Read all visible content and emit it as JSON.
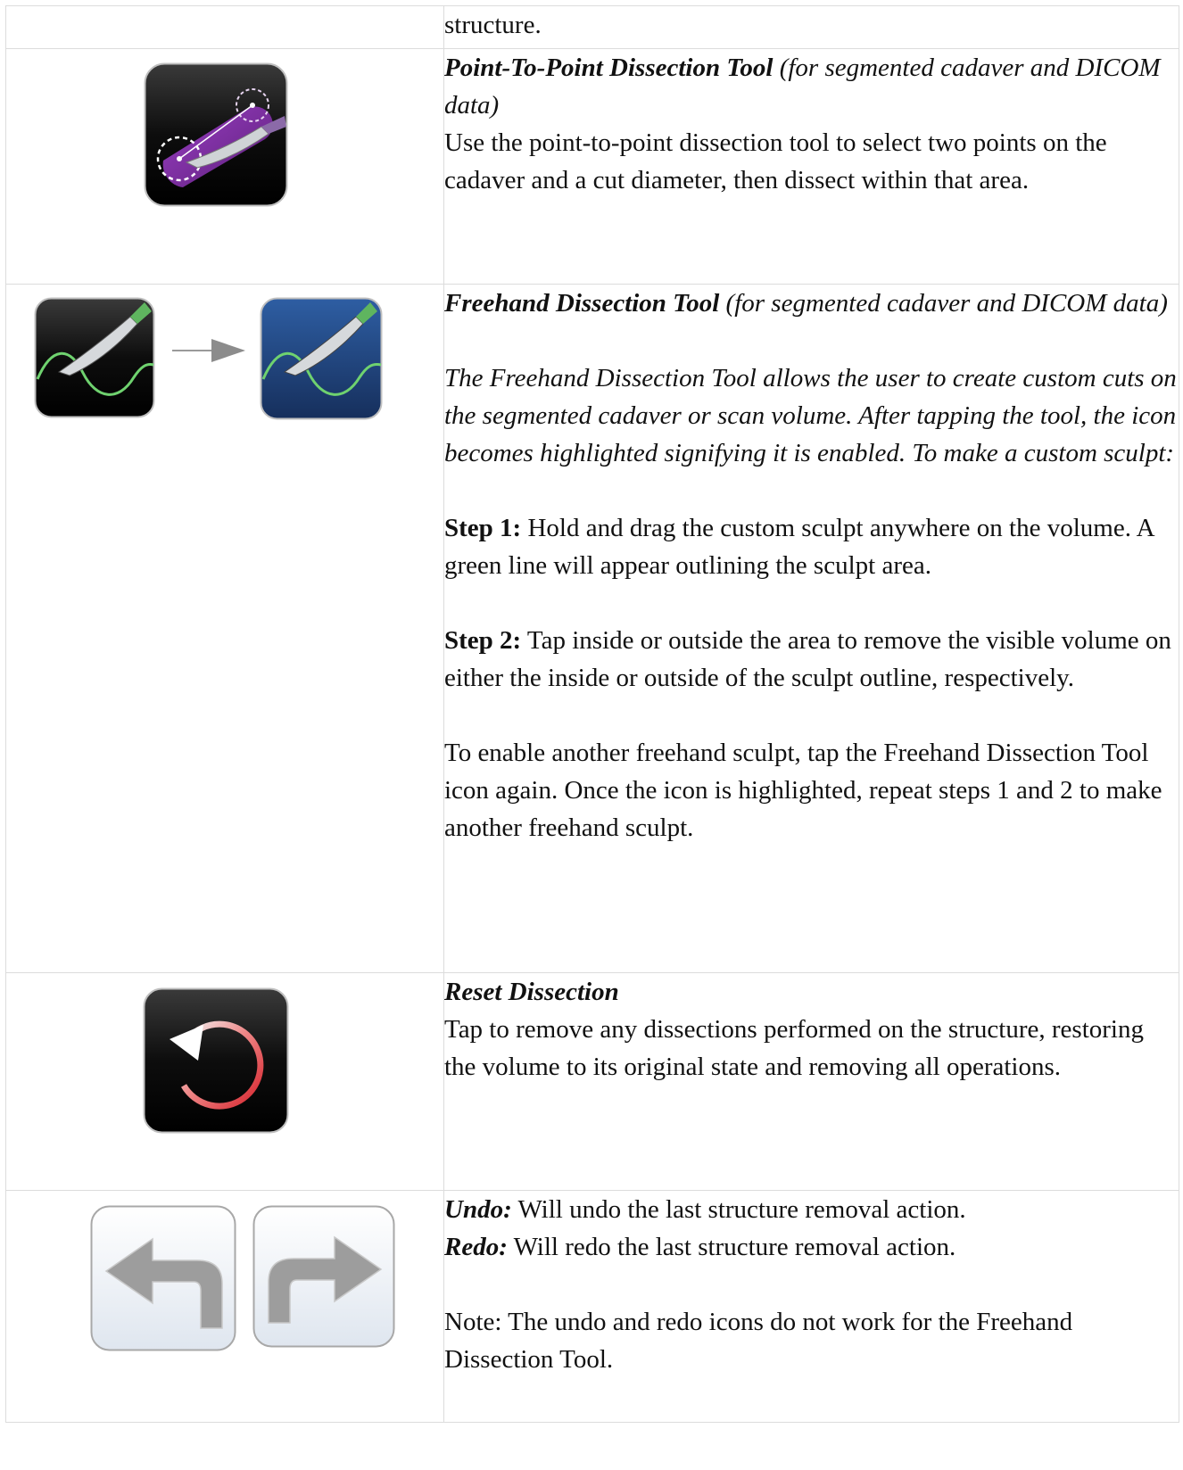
{
  "rows": {
    "r0": {
      "text": "structure."
    },
    "r1": {
      "title": "Point-To-Point Dissection Tool",
      "subtitle": " (for segmented cadaver and DICOM data)",
      "body": "Use the point-to-point dissection tool to select two points on the cadaver and a cut diameter, then dissect within that area."
    },
    "r2": {
      "title": "Freehand Dissection Tool",
      "subtitle": " (for segmented cadaver and DICOM data)",
      "intro": "The Freehand Dissection Tool allows the user to create custom cuts on the segmented cadaver or scan volume. After tapping the tool, the icon becomes highlighted signifying it is enabled. To make a custom sculpt:",
      "step1_label": "Step 1:",
      "step1_text": " Hold and drag the custom sculpt anywhere on the volume. A green line will appear outlining the sculpt area.",
      "step2_label": "Step 2:",
      "step2_text": " Tap inside or outside the area to remove the visible volume on either the inside or outside of the sculpt outline, respectively.",
      "closing": "To enable another freehand sculpt, tap the Freehand Dissection Tool icon again. Once the icon is highlighted, repeat steps 1 and 2 to make another freehand sculpt."
    },
    "r3": {
      "title": "Reset Dissection",
      "body": "Tap to remove any dissections performed on the structure, restoring the volume to its original state and removing all operations."
    },
    "r4": {
      "undo_label": "Undo:",
      "undo_text": " Will undo the last structure removal action.",
      "redo_label": "Redo:",
      "redo_text": " Will redo the last structure removal action.",
      "note": "Note: The undo and redo icons do not work for the Freehand Dissection Tool."
    }
  },
  "icons": {
    "point_to_point": "scalpel-point-to-point-icon",
    "freehand_off": "freehand-scalpel-icon",
    "freehand_on": "freehand-scalpel-highlighted-icon",
    "arrow": "arrow-right-icon",
    "reset": "reset-circular-arrow-icon",
    "undo": "undo-arrow-icon",
    "redo": "redo-arrow-icon"
  },
  "colors": {
    "icon_dark": "#0d0d0d",
    "icon_blue": "#1f4a86",
    "purple": "#7a2d9e",
    "green_line": "#6fd26f",
    "reset_red": "#d6232c",
    "undo_gray": "#9a9a9a"
  }
}
